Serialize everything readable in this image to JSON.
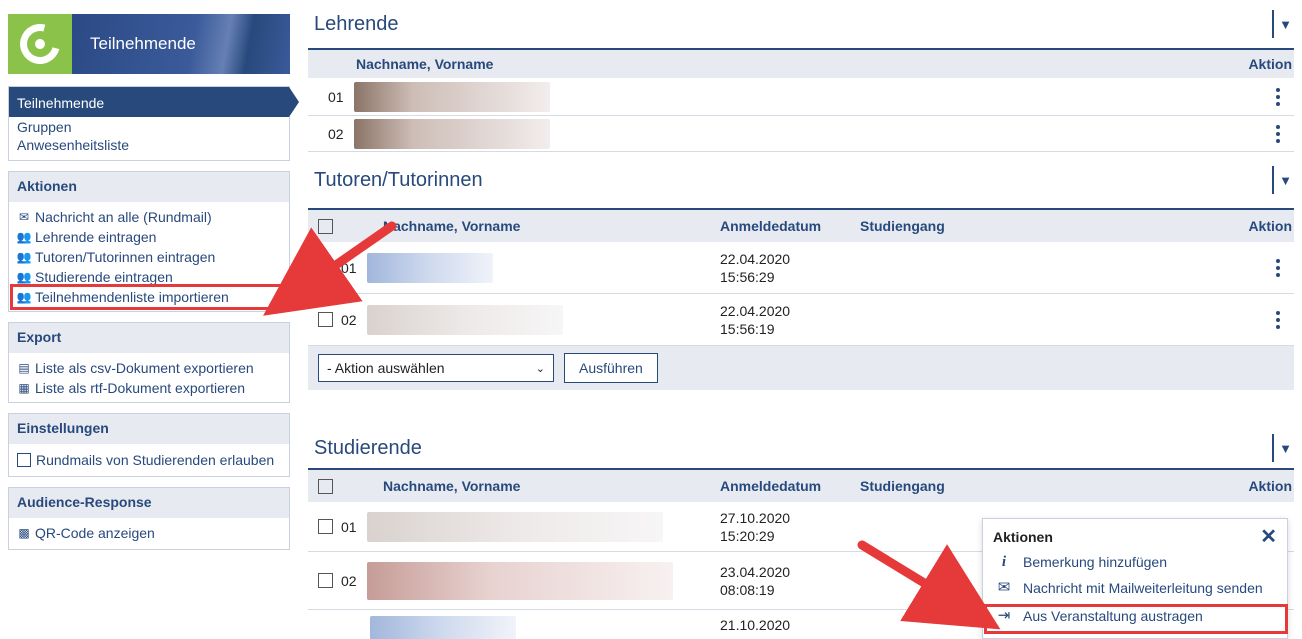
{
  "sidebar": {
    "brand_title": "Teilnehmende",
    "nav": {
      "active": "Teilnehmende",
      "links": [
        "Gruppen",
        "Anwesenheitsliste"
      ]
    },
    "aktionen": {
      "title": "Aktionen",
      "items": [
        "Nachricht an alle (Rundmail)",
        "Lehrende eintragen",
        "Tutoren/Tutorinnen eintragen",
        "Studierende eintragen",
        "Teilnehmendenliste importieren"
      ]
    },
    "export": {
      "title": "Export",
      "items": [
        "Liste als csv-Dokument exportieren",
        "Liste als rtf-Dokument exportieren"
      ]
    },
    "einstellungen": {
      "title": "Einstellungen",
      "items": [
        "Rundmails von Studierenden erlauben"
      ]
    },
    "audience": {
      "title": "Audience-Response",
      "items": [
        "QR-Code anzeigen"
      ]
    }
  },
  "lehrende": {
    "title": "Lehrende",
    "col_name": "Nachname, Vorname",
    "col_action": "Aktion",
    "rows": [
      {
        "num": "01"
      },
      {
        "num": "02"
      }
    ]
  },
  "tutoren": {
    "title": "Tutoren/Tutorinnen",
    "col_name": "Nachname, Vorname",
    "col_date": "Anmeldedatum",
    "col_course": "Studiengang",
    "col_action": "Aktion",
    "rows": [
      {
        "num": "01",
        "date": "22.04.2020",
        "time": "15:56:29"
      },
      {
        "num": "02",
        "date": "22.04.2020",
        "time": "15:56:19"
      }
    ],
    "select_value": "- Aktion auswählen",
    "button": "Ausführen"
  },
  "studierende": {
    "title": "Studierende",
    "col_name": "Nachname, Vorname",
    "col_date": "Anmeldedatum",
    "col_course": "Studiengang",
    "col_action": "Aktion",
    "rows": [
      {
        "num": "01",
        "date": "27.10.2020",
        "time": "15:20:29"
      },
      {
        "num": "02",
        "date": "23.04.2020",
        "time": "08:08:19"
      },
      {
        "num": "",
        "date": "21.10.2020",
        "time": ""
      }
    ]
  },
  "context_menu": {
    "title": "Aktionen",
    "items": [
      "Bemerkung hinzufügen",
      "Nachricht mit Mailweiterleitung senden",
      "Aus Veranstaltung austragen"
    ]
  },
  "colors": {
    "primary": "#28497c",
    "header_bg": "#e7ebf1",
    "brand_green": "#8bc34a",
    "highlight": "#e6393a"
  }
}
